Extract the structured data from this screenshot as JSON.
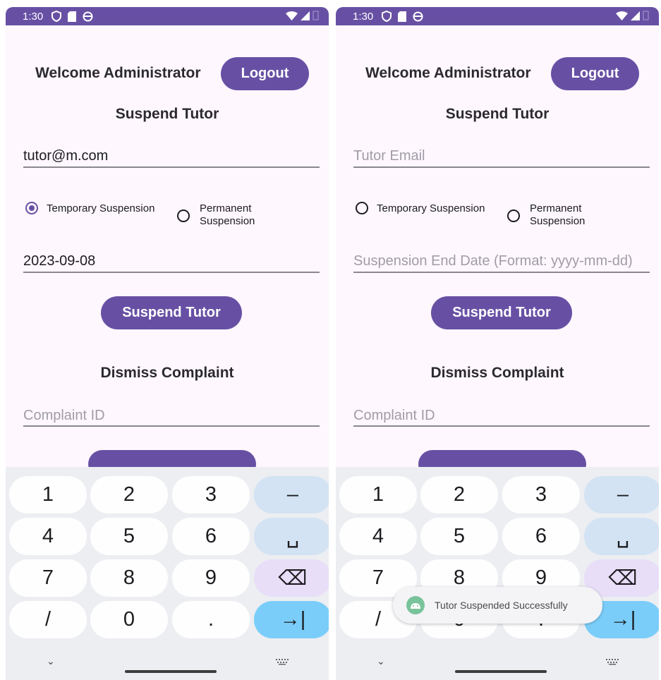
{
  "status_bar": {
    "time": "1:30"
  },
  "header": {
    "welcome": "Welcome Administrator",
    "logout": "Logout"
  },
  "suspend": {
    "title": "Suspend Tutor",
    "email_placeholder": "Tutor Email",
    "radio_temporary": "Temporary Suspension",
    "radio_permanent_line1": "Permanent",
    "radio_permanent_line2": "Suspension",
    "date_placeholder": "Suspension End Date (Format: yyyy-mm-dd)",
    "button": "Suspend Tutor"
  },
  "dismiss": {
    "title": "Dismiss Complaint",
    "complaint_placeholder": "Complaint ID"
  },
  "left_screen": {
    "email_value": "tutor@m.com",
    "date_value": "2023-09-08",
    "temporary_selected": true
  },
  "right_screen": {
    "email_value": "",
    "date_value": "",
    "temporary_selected": false
  },
  "keyboard": {
    "keys": [
      "1",
      "2",
      "3",
      "–",
      "4",
      "5",
      "6",
      "␣",
      "7",
      "8",
      "9",
      "⌫",
      "/",
      "0",
      ".",
      "→|"
    ]
  },
  "toast": {
    "message": "Tutor Suspended Successfully"
  },
  "colors": {
    "primary": "#6750a4",
    "background": "#fef7fe",
    "keyboard": "#eceef2"
  }
}
